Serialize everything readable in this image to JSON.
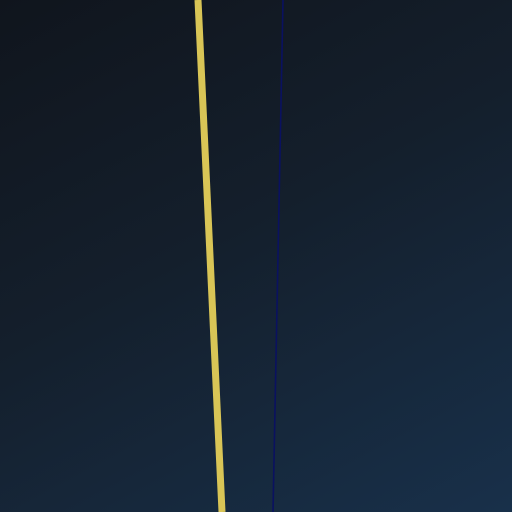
{
  "scene": {
    "background_colors": [
      "#10151d",
      "#141f2c",
      "#18304a"
    ],
    "lines": [
      {
        "name": "yellow-line",
        "color": "#d9c556"
      },
      {
        "name": "dark-blue-line",
        "color": "#0a1160"
      }
    ]
  }
}
